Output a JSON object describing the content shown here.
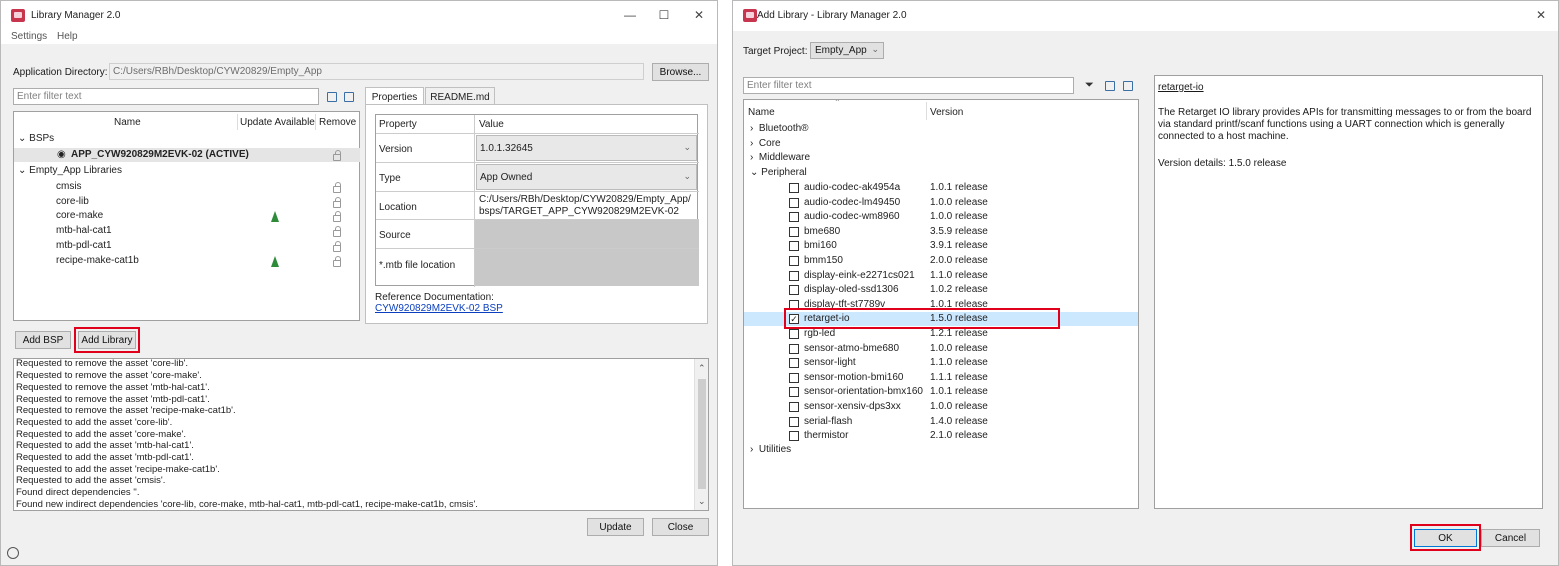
{
  "left_window": {
    "title": "Library Manager 2.0",
    "controls": {
      "minimize": "—",
      "maximize": "☐",
      "close": "✕"
    },
    "menu": [
      "Settings",
      "Help"
    ],
    "app_dir_label": "Application Directory:",
    "app_dir_value": "C:/Users/RBh/Desktop/CYW20829/Empty_App",
    "browse_label": "Browse...",
    "filter_placeholder": "Enter filter text",
    "columns": {
      "name": "Name",
      "update": "Update Available",
      "remove": "Remove"
    },
    "bsps_group": "BSPs",
    "bsp_item": "APP_CYW920829M2EVK-02 (ACTIVE)",
    "libs_group": "Empty_App Libraries",
    "libraries": [
      {
        "name": "cmsis",
        "update": false
      },
      {
        "name": "core-lib",
        "update": false
      },
      {
        "name": "core-make",
        "update": true
      },
      {
        "name": "mtb-hal-cat1",
        "update": false
      },
      {
        "name": "mtb-pdl-cat1",
        "update": false
      },
      {
        "name": "recipe-make-cat1b",
        "update": true
      }
    ],
    "tabs": [
      "Properties",
      "README.md"
    ],
    "prop_headers": {
      "property": "Property",
      "value": "Value"
    },
    "props": {
      "version_label": "Version",
      "version_value": "1.0.1.32645",
      "type_label": "Type",
      "type_value": "App Owned",
      "location_label": "Location",
      "location_line1": "C:/Users/RBh/Desktop/CYW20829/Empty_App/",
      "location_line2": "bsps/TARGET_APP_CYW920829M2EVK-02",
      "source_label": "Source",
      "mtb_label": "*.mtb file location"
    },
    "ref_doc_label": "Reference Documentation:",
    "ref_doc_link": "CYW920829M2EVK-02 BSP",
    "add_bsp_label": "Add BSP",
    "add_library_label": "Add Library",
    "log_lines": [
      "Requested to remove the asset 'core-lib'.",
      "Requested to remove the asset 'core-make'.",
      "Requested to remove the asset 'mtb-hal-cat1'.",
      "Requested to remove the asset 'mtb-pdl-cat1'.",
      "Requested to remove the asset 'recipe-make-cat1b'.",
      "Requested to add the asset 'core-lib'.",
      "Requested to add the asset 'core-make'.",
      "Requested to add the asset 'mtb-hal-cat1'.",
      "Requested to add the asset 'mtb-pdl-cat1'.",
      "Requested to add the asset 'recipe-make-cat1b'.",
      "Requested to add the asset 'cmsis'.",
      "Found direct dependencies ''.",
      "Found new indirect dependencies 'core-lib, core-make, mtb-hal-cat1, mtb-pdl-cat1, recipe-make-cat1b, cmsis'."
    ],
    "update_label": "Update",
    "close_label": "Close"
  },
  "right_window": {
    "title": "Add Library - Library Manager 2.0",
    "close_icon": "✕",
    "target_label": "Target Project:",
    "target_value": "Empty_App",
    "filter_placeholder": "Enter filter text",
    "columns": {
      "name": "Name",
      "version": "Version"
    },
    "categories_top": [
      "Bluetooth®",
      "Core",
      "Middleware"
    ],
    "peripheral_label": "Peripheral",
    "peripherals": [
      {
        "name": "audio-codec-ak4954a",
        "version": "1.0.1 release",
        "checked": false
      },
      {
        "name": "audio-codec-lm49450",
        "version": "1.0.0 release",
        "checked": false
      },
      {
        "name": "audio-codec-wm8960",
        "version": "1.0.0 release",
        "checked": false
      },
      {
        "name": "bme680",
        "version": "3.5.9 release",
        "checked": false
      },
      {
        "name": "bmi160",
        "version": "3.9.1 release",
        "checked": false
      },
      {
        "name": "bmm150",
        "version": "2.0.0 release",
        "checked": false
      },
      {
        "name": "display-eink-e2271cs021",
        "version": "1.1.0 release",
        "checked": false
      },
      {
        "name": "display-oled-ssd1306",
        "version": "1.0.2 release",
        "checked": false
      },
      {
        "name": "display-tft-st7789v",
        "version": "1.0.1 release",
        "checked": false
      },
      {
        "name": "retarget-io",
        "version": "1.5.0 release",
        "checked": true
      },
      {
        "name": "rgb-led",
        "version": "1.2.1 release",
        "checked": false
      },
      {
        "name": "sensor-atmo-bme680",
        "version": "1.0.0 release",
        "checked": false
      },
      {
        "name": "sensor-light",
        "version": "1.1.0 release",
        "checked": false
      },
      {
        "name": "sensor-motion-bmi160",
        "version": "1.1.1 release",
        "checked": false
      },
      {
        "name": "sensor-orientation-bmx160",
        "version": "1.0.1 release",
        "checked": false
      },
      {
        "name": "sensor-xensiv-dps3xx",
        "version": "1.0.0 release",
        "checked": false
      },
      {
        "name": "serial-flash",
        "version": "1.4.0 release",
        "checked": false
      },
      {
        "name": "thermistor",
        "version": "2.1.0 release",
        "checked": false
      }
    ],
    "utilities_label": "Utilities",
    "detail_title": "retarget-io",
    "detail_line1": "The Retarget IO library provides APIs for transmitting messages to or from the board",
    "detail_line2": "via standard printf/scanf functions using a UART connection which is generally",
    "detail_line3": "connected to a host machine.",
    "detail_version": "Version details: 1.5.0 release",
    "ok_label": "OK",
    "cancel_label": "Cancel"
  },
  "colors": {
    "highlight_red": "#e0001b",
    "update_arrow": "#2e8b3a",
    "selected_row": "#cce8ff"
  }
}
